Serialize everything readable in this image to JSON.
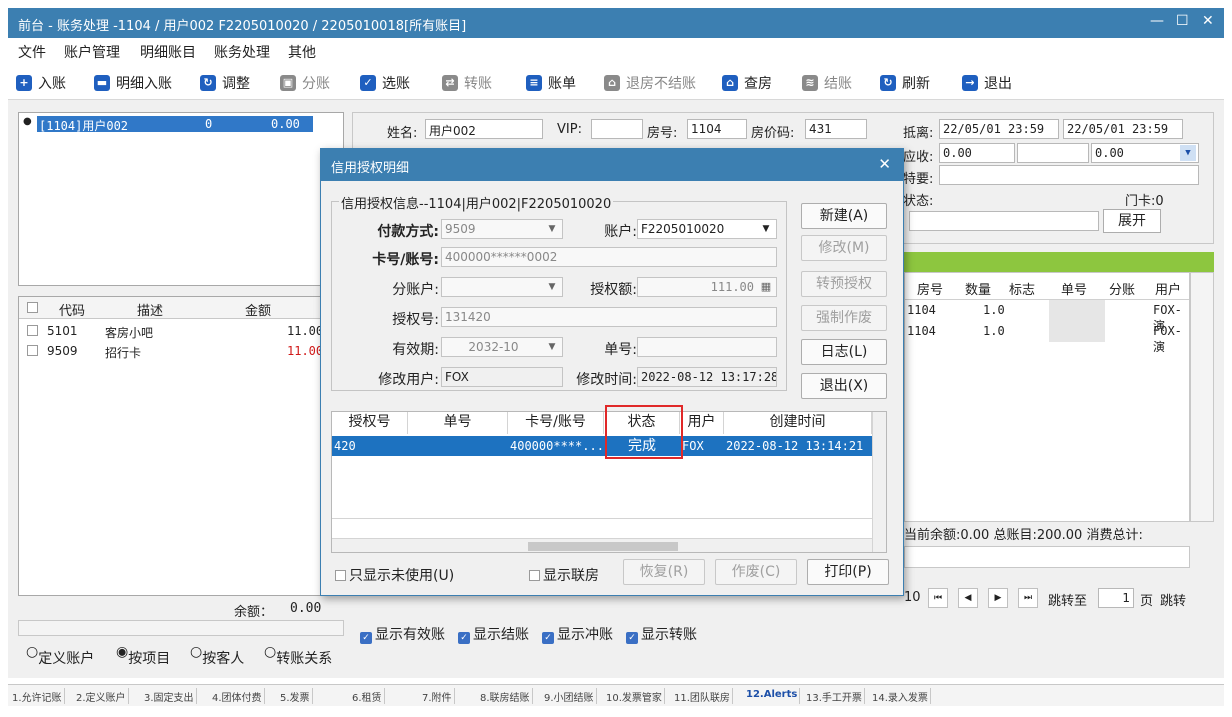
{
  "window": {
    "title": "前台 - 账务处理 -1104 / 用户002  F2205010020 / 2205010018[所有账目]",
    "controls": [
      "—",
      "☐",
      "✕"
    ]
  },
  "menu": [
    "文件",
    "账户管理",
    "明细账目",
    "账务处理",
    "其他"
  ],
  "toolbar": [
    {
      "label": "入账",
      "icon": "plus-circle-icon",
      "color": "#1f5fbf",
      "glyph": "+",
      "enabled": true
    },
    {
      "label": "明细入账",
      "icon": "monitor-icon",
      "color": "#1f5fbf",
      "glyph": "▬",
      "enabled": true
    },
    {
      "label": "调整",
      "icon": "adjust-icon",
      "color": "#1f5fbf",
      "glyph": "↻",
      "enabled": true
    },
    {
      "label": "分账",
      "icon": "split-icon",
      "color": "#8a8a8a",
      "glyph": "▣",
      "enabled": false
    },
    {
      "label": "选账",
      "icon": "check-select-icon",
      "color": "#1f5fbf",
      "glyph": "✓",
      "enabled": true
    },
    {
      "label": "转账",
      "icon": "transfer-icon",
      "color": "#8a8a8a",
      "glyph": "⇄",
      "enabled": false
    },
    {
      "label": "账单",
      "icon": "bill-icon",
      "color": "#1f5fbf",
      "glyph": "≡",
      "enabled": true
    },
    {
      "label": "退房不结账",
      "icon": "checkout-icon",
      "color": "#8a8a8a",
      "glyph": "⌂",
      "enabled": false
    },
    {
      "label": "查房",
      "icon": "room-check-icon",
      "color": "#1f5fbf",
      "glyph": "⌂",
      "enabled": true
    },
    {
      "label": "结账",
      "icon": "settle-icon",
      "color": "#8a8a8a",
      "glyph": "≋",
      "enabled": false
    },
    {
      "label": "刷新",
      "icon": "refresh-icon",
      "color": "#1f5fbf",
      "glyph": "↻",
      "enabled": true
    },
    {
      "label": "退出",
      "icon": "exit-icon",
      "color": "#1f5fbf",
      "glyph": "→",
      "enabled": true
    }
  ],
  "accounts": {
    "selected": {
      "id": "[1104]用户002",
      "count": "0",
      "amount": "0.00"
    }
  },
  "items_table": {
    "headers": [
      "代码",
      "描述",
      "金额"
    ],
    "rows": [
      {
        "code": "5101",
        "desc": "客房小吧",
        "amount": "11.00",
        "red": false
      },
      {
        "code": "9509",
        "desc": "招行卡",
        "amount": "11.00",
        "red": true
      }
    ],
    "balance_label": "余额：",
    "balance_value": "0.00"
  },
  "view_modes": {
    "options": [
      "定义账户",
      "按项目",
      "按客人",
      "转账关系"
    ],
    "selected": "按项目"
  },
  "guest_info": {
    "name_label": "姓名:",
    "name_value": "用户002",
    "vip_label": "VIP:",
    "vip_value": "",
    "room_label": "房号:",
    "room_value": "1104",
    "rate_label": "房价码:",
    "rate_value": "431",
    "depart_label": "抵离:",
    "arrive_value": "22/05/01 23:59",
    "leave_value": "22/05/01 23:59",
    "receivable_label": "应收:",
    "receivable_value": "0.00",
    "receivable_value2": "0.00",
    "special_label": "特要:",
    "status_label": "状态:",
    "doorcard_label": "门卡:",
    "doorcard_value": "0",
    "expand_button": "展开"
  },
  "right_table": {
    "headers": [
      "房号",
      "数量",
      "标志",
      "单号",
      "分账",
      "用户"
    ],
    "rows": [
      {
        "room": "1104",
        "qty": "1.0",
        "user": "FOX-演"
      },
      {
        "room": "1104",
        "qty": "1.0",
        "user": "FOX-演"
      }
    ],
    "totals": "当前余额:0.00  总账目:200.00  消费总计:"
  },
  "pager": {
    "page_size": "10",
    "jump_label": "跳转至",
    "page_value": "1",
    "page_unit": "页",
    "jump_button": "跳转"
  },
  "bottom_checks": [
    "显示有效账",
    "显示结账",
    "显示冲账",
    "显示转账"
  ],
  "status_tabs": [
    "1.允许记账",
    "2.定义账户",
    "3.固定支出",
    "4.团体付费",
    "5.发票",
    "6.租赁",
    "7.附件",
    "8.联房结账",
    "9.小团结账",
    "10.发票管家",
    "11.团队联房",
    "12.Alerts",
    "13.手工开票",
    "14.录入发票"
  ],
  "active_tab": "12.Alerts",
  "dialog": {
    "title": "信用授权明细",
    "group_title": "信用授权信息--1104|用户002|F2205010020",
    "payment_label": "付款方式:",
    "payment_value": "9509",
    "account_label": "账户:",
    "account_value": "F2205010020",
    "card_label": "卡号/账号:",
    "card_value": "400000******0002",
    "subaccount_label": "分账户:",
    "subaccount_value": "",
    "auth_amount_label": "授权额:",
    "auth_amount_value": "111.00",
    "auth_no_label": "授权号:",
    "auth_no_value": "131420",
    "expiry_label": "有效期:",
    "expiry_value": "2032-10",
    "order_label": "单号:",
    "order_value": "",
    "modify_user_label": "修改用户:",
    "modify_user_value": "FOX",
    "modify_time_label": "修改时间:",
    "modify_time_value": "2022-08-12 13:17:28",
    "buttons": {
      "new": "新建(A)",
      "modify": "修改(M)",
      "pre_auth": "转预授权",
      "force_void": "强制作废",
      "log": "日志(L)",
      "exit": "退出(X)"
    },
    "grid": {
      "headers": [
        "授权号",
        "单号",
        "卡号/账号",
        "状态",
        "用户",
        "创建时间"
      ],
      "row": {
        "auth_no": "420",
        "order_no": "",
        "card": "400000****...",
        "status": "完成",
        "user": "FOX",
        "created": "2022-08-12 13:14:21"
      }
    },
    "only_unused_label": "只显示未使用(U)",
    "show_linked_label": "显示联房",
    "restore_button": "恢复(R)",
    "void_button": "作废(C)",
    "print_button": "打印(P)"
  }
}
